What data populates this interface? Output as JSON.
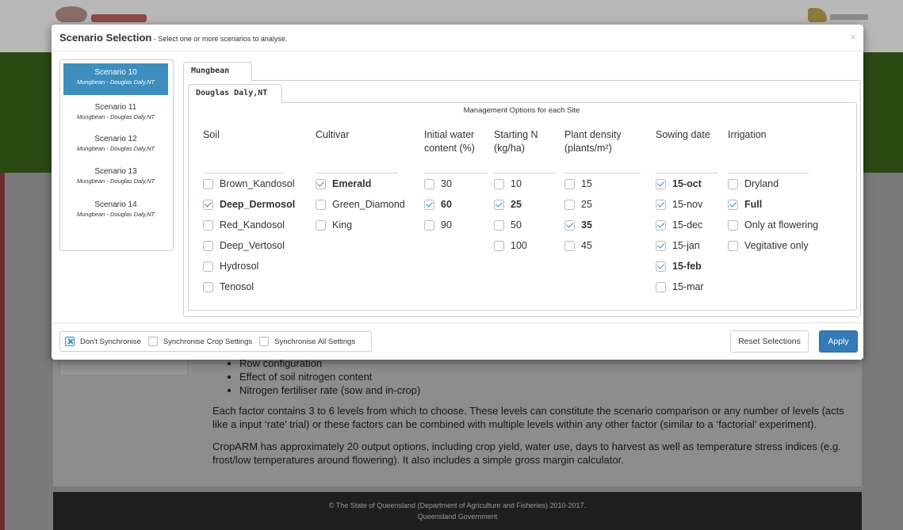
{
  "background": {
    "bullets": [
      "Row configuration",
      "Effect of soil nitrogen content",
      "Nitrogen fertiliser rate (sow and in-crop)"
    ],
    "paragraph1": "Each factor contains 3 to 6 levels from which to choose. These levels can constitute the scenario comparison or any number of levels (acts like a input ‘rate’ trial) or these factors can be combined with multiple levels within any other factor (similar to a ‘factorial’ experiment).",
    "paragraph2": "CropARM has approximately 20 output options, including crop yield, water use, days to harvest as well as temperature stress indices (e.g. frost/low temperatures around flowering). It also includes a simple gross margin calculator.",
    "footer_line1": "© The State of Queensland (Department of Agriculture and Fisheries) 2010-2017.",
    "footer_line2": "Queensland Government"
  },
  "modal": {
    "title": "Scenario Selection",
    "subtitle": " - Select one or more scenarios to analyse.",
    "close": "×"
  },
  "scenarios": [
    {
      "name": "Scenario 10",
      "location": "Mungbean - Douglas Daly,NT",
      "active": true
    },
    {
      "name": "Scenario 11",
      "location": "Mungbean - Douglas Daly,NT",
      "active": false
    },
    {
      "name": "Scenario 12",
      "location": "Mungbean - Douglas Daly,NT",
      "active": false
    },
    {
      "name": "Scenario 13",
      "location": "Mungbean - Douglas Daly,NT",
      "active": false
    },
    {
      "name": "Scenario 14",
      "location": "Mungbean - Douglas Daly,NT",
      "active": false
    }
  ],
  "crop_tab": "Mungbean",
  "site_tab": "Douglas Daly,NT",
  "management_title": "Management Options for each Site",
  "columns": [
    {
      "header": "Soil",
      "options": [
        {
          "label": "Brown_Kandosol",
          "checked": false
        },
        {
          "label": "Deep_Dermosol",
          "checked": true
        },
        {
          "label": "Red_Kandosol",
          "checked": false
        },
        {
          "label": "Deep_Vertosol",
          "checked": false
        },
        {
          "label": "Hydrosol",
          "checked": false
        },
        {
          "label": "Tenosol",
          "checked": false
        }
      ]
    },
    {
      "header": "Cultivar",
      "options": [
        {
          "label": "Emerald",
          "checked": true
        },
        {
          "label": "Green_Diamond",
          "checked": false
        },
        {
          "label": "King",
          "checked": false
        }
      ]
    },
    {
      "header": "Initial water content (%)",
      "options": [
        {
          "label": "30",
          "checked": false
        },
        {
          "label": "60",
          "checked": true
        },
        {
          "label": "90",
          "checked": false
        }
      ]
    },
    {
      "header": "Starting N (kg/ha)",
      "options": [
        {
          "label": "10",
          "checked": false
        },
        {
          "label": "25",
          "checked": true
        },
        {
          "label": "50",
          "checked": false
        },
        {
          "label": "100",
          "checked": false
        }
      ]
    },
    {
      "header": "Plant density (plants/m²)",
      "options": [
        {
          "label": "15",
          "checked": false
        },
        {
          "label": "25",
          "checked": false
        },
        {
          "label": "35",
          "checked": true
        },
        {
          "label": "45",
          "checked": false
        }
      ]
    },
    {
      "header": "Sowing date",
      "options": [
        {
          "label": "15-oct",
          "checked": true
        },
        {
          "label": "15-nov",
          "checked": true
        },
        {
          "label": "15-dec",
          "checked": true
        },
        {
          "label": "15-jan",
          "checked": true
        },
        {
          "label": "15-feb",
          "checked": true
        },
        {
          "label": "15-mar",
          "checked": false
        }
      ]
    },
    {
      "header": "Irrigation",
      "options": [
        {
          "label": "Dryland",
          "checked": false
        },
        {
          "label": "Full",
          "checked": true
        },
        {
          "label": "Only at flowering",
          "checked": false
        },
        {
          "label": "Vegitative only",
          "checked": false
        }
      ]
    }
  ],
  "sync_options": [
    {
      "label": "Don't Synchronise",
      "checked": true
    },
    {
      "label": "Synchronise Crop Settings",
      "checked": false
    },
    {
      "label": "Synchronise All Settings",
      "checked": false
    }
  ],
  "buttons": {
    "reset": "Reset Selections",
    "apply": "Apply"
  },
  "colors": {
    "accent": "#337ab7",
    "active_scenario": "#3e8ebd",
    "banner": "#2b4a14"
  }
}
